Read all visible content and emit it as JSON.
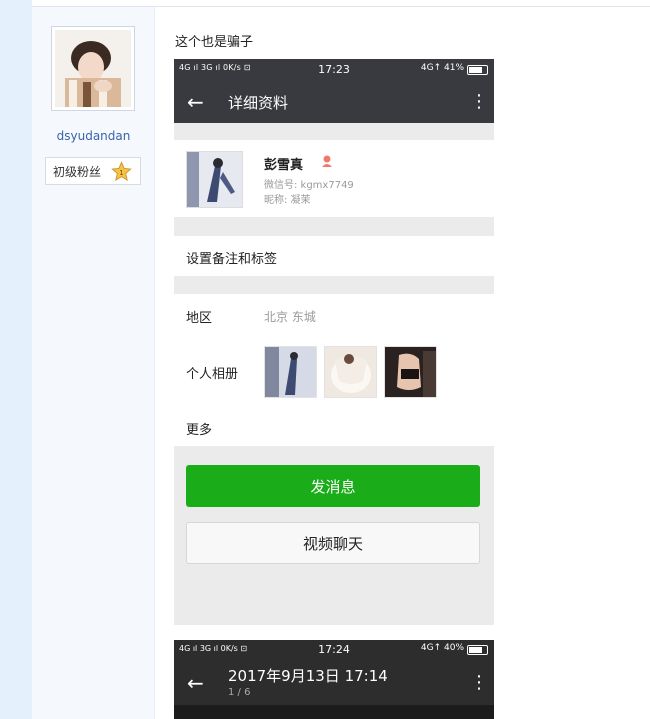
{
  "author": {
    "username": "dsyudandan",
    "rank_label": "初级粉丝",
    "rank_level": "1"
  },
  "post": {
    "text": "这个也是骗子"
  },
  "screenshot1": {
    "status": {
      "left": "4G ıl 3G ıl 0K/s ⊡",
      "time": "17:23",
      "right": "4G↑ 41%"
    },
    "title": "详细资料",
    "profile": {
      "name": "彭雪真",
      "wechat_id": "微信号: kgmx7749",
      "nickname": "昵称: 凝茉"
    },
    "remark_label": "设置备注和标签",
    "region_label": "地区",
    "region_value": "北京 东城",
    "album_label": "个人相册",
    "more_label": "更多",
    "send_button": "发消息",
    "video_button": "视频聊天",
    "colors": {
      "header": "#393a3f",
      "send_green": "#1aad19"
    }
  },
  "screenshot2": {
    "status": {
      "left": "4G ıl 3G ıl 0K/s ⊡",
      "time": "17:24",
      "right": "4G↑ 40%"
    },
    "title": "2017年9月13日 17:14",
    "page_indicator": "1 / 6"
  }
}
